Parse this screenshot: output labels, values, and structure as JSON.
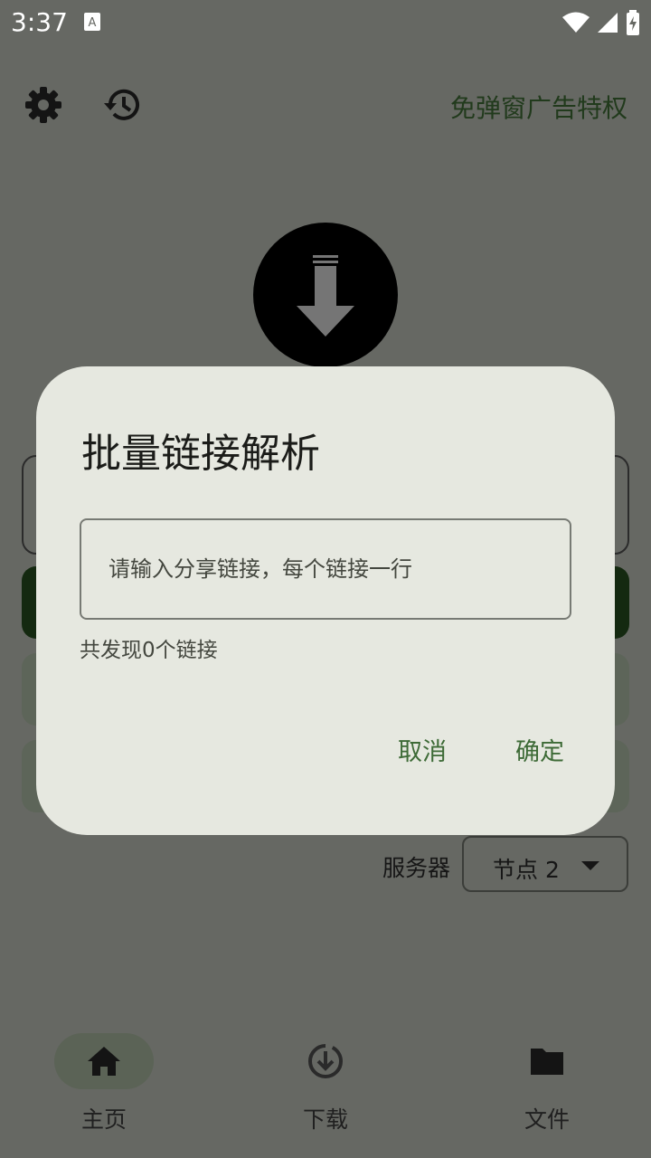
{
  "status_bar": {
    "time": "3:37",
    "icons": [
      "app-notification-icon",
      "wifi-icon",
      "signal-icon",
      "battery-icon"
    ]
  },
  "topbar": {
    "settings_icon": "gear-icon",
    "history_icon": "history-icon",
    "ad_free_link": "免弹窗广告特权"
  },
  "server": {
    "label": "服务器",
    "selected": "节点 2"
  },
  "bottom_nav": {
    "items": [
      {
        "label": "主页",
        "icon": "home-icon",
        "active": true
      },
      {
        "label": "下载",
        "icon": "download-circle-icon",
        "active": false
      },
      {
        "label": "文件",
        "icon": "folder-icon",
        "active": false
      }
    ]
  },
  "dialog": {
    "title": "批量链接解析",
    "input_placeholder": "请输入分享链接，每个链接一行",
    "input_value": "",
    "count_text": "共发现0个链接",
    "cancel_label": "取消",
    "confirm_label": "确定"
  },
  "colors": {
    "accent": "#3d6a36",
    "dialog_bg": "#e6e8e0",
    "scrim": "#666863"
  }
}
